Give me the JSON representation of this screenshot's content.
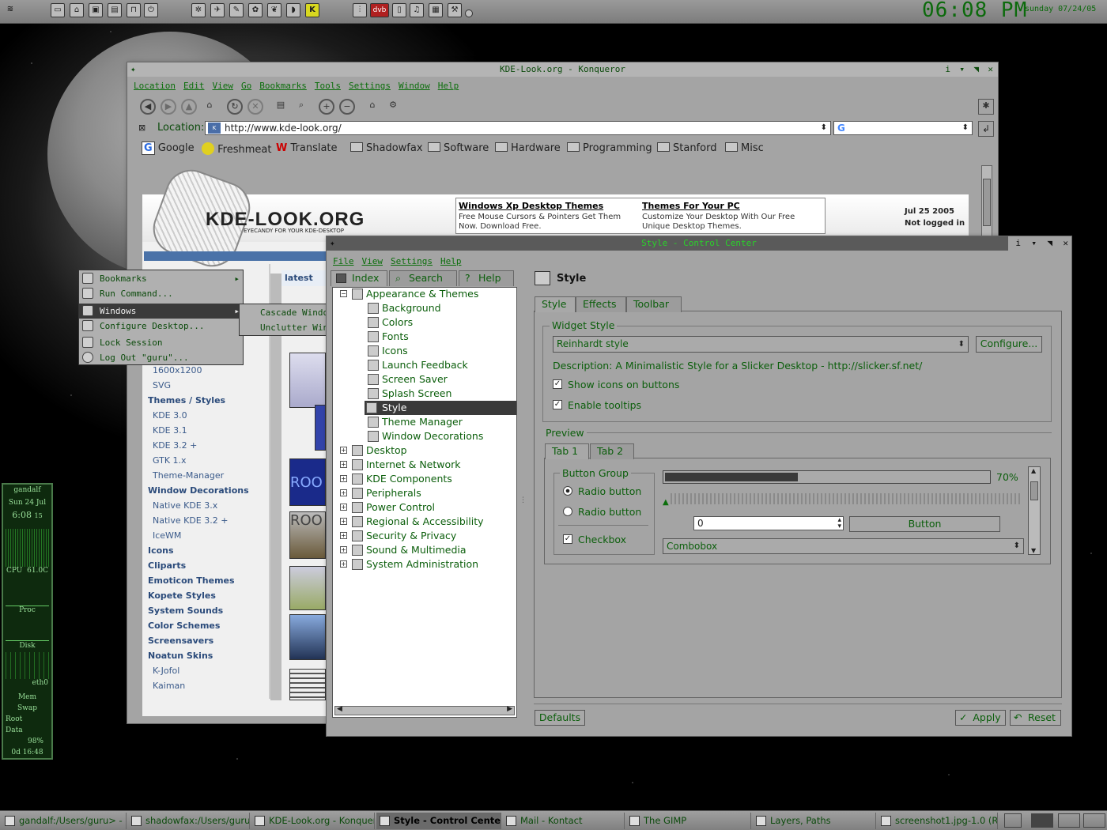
{
  "panel": {
    "clock": "06:08 PM",
    "date": "sunday 07/24/05",
    "dvb_label": "dvb"
  },
  "konqueror": {
    "title": "KDE-Look.org - Konqueror",
    "menu": [
      "Location",
      "Edit",
      "View",
      "Go",
      "Bookmarks",
      "Tools",
      "Settings",
      "Window",
      "Help"
    ],
    "location_label": "Location:",
    "url": "http://www.kde-look.org/",
    "bookmarks": [
      "Google",
      "Freshmeat",
      "Translate",
      "Shadowfax",
      "Software",
      "Hardware",
      "Programming",
      "Stanford",
      "Misc"
    ],
    "page": {
      "logo": "KDE-LOOK.ORG",
      "tagline": "EYECANDY FOR YOUR KDE-DESKTOP",
      "ad1_title": "Windows Xp Desktop Themes",
      "ad1_text": "Free Mouse Cursors & Pointers Get Them Now. Download Free.",
      "ad2_title": "Themes For Your PC",
      "ad2_text": "Customize Your Desktop With Our Free Unique Desktop Themes.",
      "date": "Jul 25 2005",
      "login": "Not logged in",
      "latest": "latest",
      "sidebar": [
        {
          "t": "1600x1200",
          "h": false
        },
        {
          "t": "SVG",
          "h": false
        },
        {
          "t": "Themes / Styles",
          "h": true
        },
        {
          "t": "KDE 3.0",
          "h": false
        },
        {
          "t": "KDE 3.1",
          "h": false
        },
        {
          "t": "KDE 3.2 +",
          "h": false
        },
        {
          "t": "GTK 1.x",
          "h": false
        },
        {
          "t": "Theme-Manager",
          "h": false
        },
        {
          "t": "Window Decorations",
          "h": true
        },
        {
          "t": "Native KDE 3.x",
          "h": false
        },
        {
          "t": "Native KDE 3.2 +",
          "h": false
        },
        {
          "t": "IceWM",
          "h": false
        },
        {
          "t": "Icons",
          "h": true
        },
        {
          "t": "Cliparts",
          "h": true
        },
        {
          "t": "Emoticon Themes",
          "h": true
        },
        {
          "t": "Kopete Styles",
          "h": true
        },
        {
          "t": "System Sounds",
          "h": true
        },
        {
          "t": "Color Schemes",
          "h": true
        },
        {
          "t": "Screensavers",
          "h": true
        },
        {
          "t": "Noatun Skins",
          "h": true
        },
        {
          "t": "K-Jofol",
          "h": false
        },
        {
          "t": "Kaiman",
          "h": false
        }
      ],
      "thumb_text": "ROO"
    }
  },
  "desktop_menu": {
    "items": [
      "Bookmarks",
      "Run Command...",
      "Windows",
      "Configure Desktop...",
      "Lock Session",
      "Log Out \"guru\"..."
    ],
    "submenu": [
      "Cascade Windows",
      "Unclutter Windows"
    ]
  },
  "kcontrol": {
    "title": "Style - Control Center",
    "menu": [
      "File",
      "View",
      "Settings",
      "Help"
    ],
    "tabs": [
      "Index",
      "Search",
      "Help"
    ],
    "tree": [
      {
        "label": "Appearance & Themes",
        "level": 0,
        "open": true
      },
      {
        "label": "Background",
        "level": 1
      },
      {
        "label": "Colors",
        "level": 1
      },
      {
        "label": "Fonts",
        "level": 1
      },
      {
        "label": "Icons",
        "level": 1
      },
      {
        "label": "Launch Feedback",
        "level": 1
      },
      {
        "label": "Screen Saver",
        "level": 1
      },
      {
        "label": "Splash Screen",
        "level": 1
      },
      {
        "label": "Style",
        "level": 1,
        "selected": true
      },
      {
        "label": "Theme Manager",
        "level": 1
      },
      {
        "label": "Window Decorations",
        "level": 1
      },
      {
        "label": "Desktop",
        "level": 0
      },
      {
        "label": "Internet & Network",
        "level": 0
      },
      {
        "label": "KDE Components",
        "level": 0
      },
      {
        "label": "Peripherals",
        "level": 0
      },
      {
        "label": "Power Control",
        "level": 0
      },
      {
        "label": "Regional & Accessibility",
        "level": 0
      },
      {
        "label": "Security & Privacy",
        "level": 0
      },
      {
        "label": "Sound & Multimedia",
        "level": 0
      },
      {
        "label": "System Administration",
        "level": 0
      }
    ],
    "module_title": "Style",
    "module_tabs": [
      "Style",
      "Effects",
      "Toolbar"
    ],
    "widget_style_label": "Widget Style",
    "widget_style": "Reinhardt style",
    "configure": "Configure...",
    "description": "Description: A Minimalistic Style for a Slicker Desktop - http://slicker.sf.net/",
    "show_icons": "Show icons on buttons",
    "enable_tooltips": "Enable tooltips",
    "preview_label": "Preview",
    "preview_tabs": [
      "Tab 1",
      "Tab 2"
    ],
    "button_group": "Button Group",
    "radio1": "Radio button",
    "radio2": "Radio button",
    "checkbox": "Checkbox",
    "progress": 0.7,
    "progress_label": "70%",
    "spin_value": "0",
    "button": "Button",
    "combobox": "Combobox",
    "defaults": "Defaults",
    "apply": "Apply",
    "reset": "Reset"
  },
  "monitor": {
    "host": "gandalf",
    "date": "Sun 24 Jul",
    "time": "6:08",
    "secs": "15",
    "cpu": "CPU",
    "cpu_val": "61.0C",
    "proc": "Proc",
    "disk": "Disk",
    "eth": "eth0",
    "mem": "Mem",
    "swap": "Swap",
    "root": "Root",
    "data": "Data",
    "batt": "98%",
    "uptime": "0d 16:48"
  },
  "taskbar": [
    {
      "label": "gandalf:/Users/guru> -",
      "active": false
    },
    {
      "label": "shadowfax:/Users/guru",
      "active": false
    },
    {
      "label": "KDE-Look.org - Konquer",
      "active": false
    },
    {
      "label": "Style - Control Center",
      "active": true
    },
    {
      "label": "Mail - Kontact",
      "active": false
    },
    {
      "label": "The GIMP",
      "active": false
    },
    {
      "label": "Layers, Paths",
      "active": false
    },
    {
      "label": "screenshot1.jpg-1.0 (R",
      "active": false
    }
  ]
}
